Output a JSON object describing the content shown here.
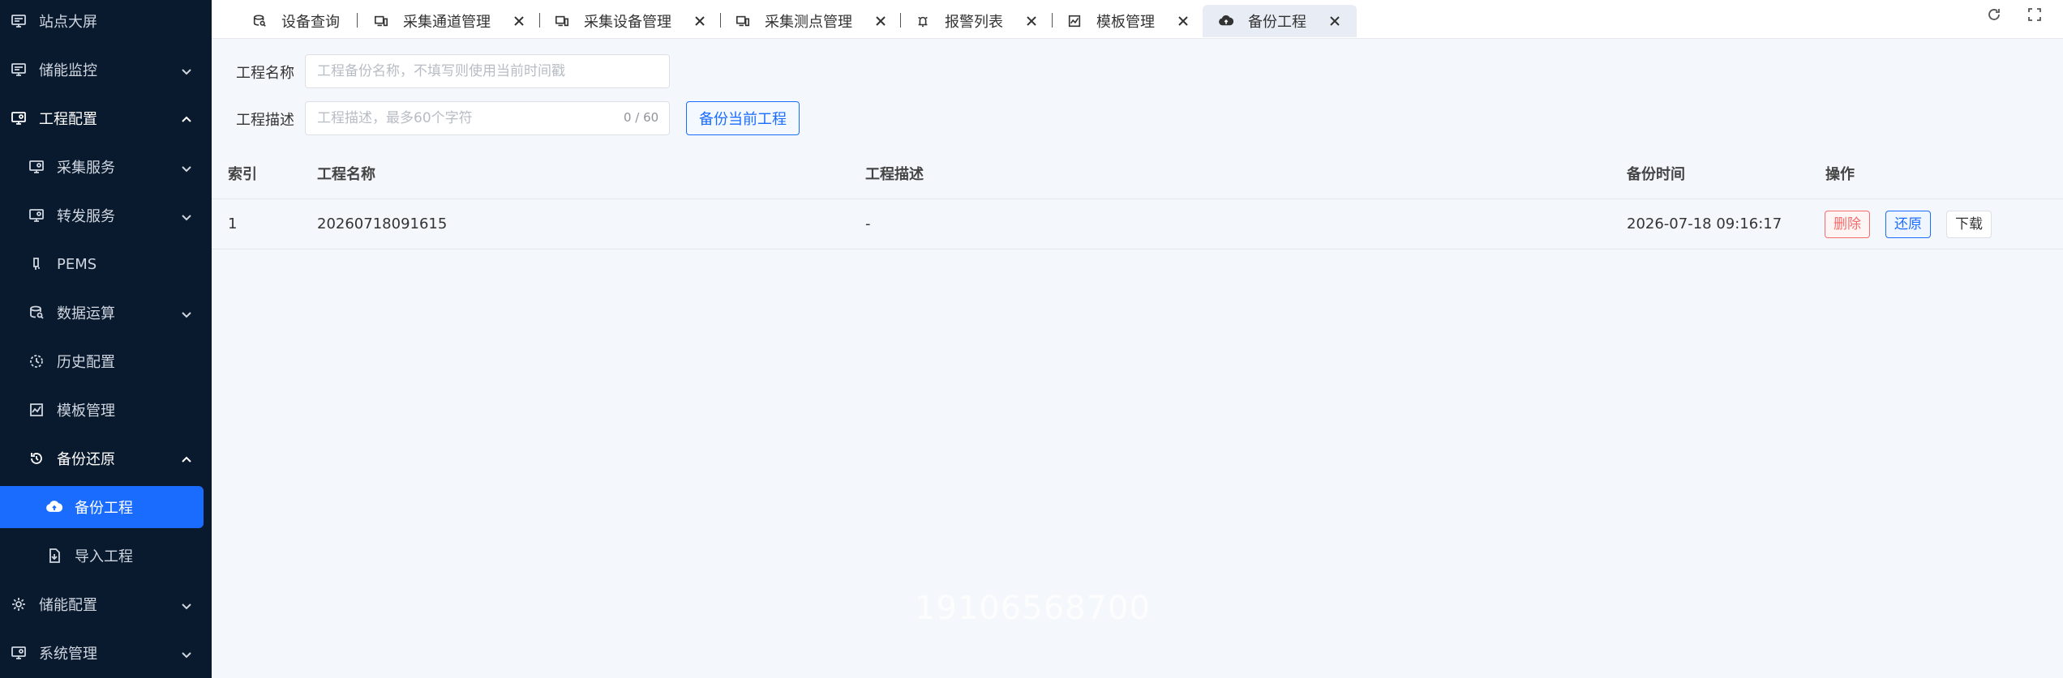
{
  "sidebar": {
    "items": [
      {
        "label": "站点大屏",
        "icon": "monitor-icon"
      },
      {
        "label": "储能监控",
        "icon": "monitor-icon"
      },
      {
        "label": "工程配置",
        "icon": "config-screen-icon"
      },
      {
        "label": "采集服务",
        "icon": "config-screen-icon"
      },
      {
        "label": "转发服务",
        "icon": "config-screen-icon"
      },
      {
        "label": "PEMS",
        "icon": "pems-icon"
      },
      {
        "label": "数据运算",
        "icon": "data-search-icon"
      },
      {
        "label": "历史配置",
        "icon": "history-icon"
      },
      {
        "label": "模板管理",
        "icon": "template-icon"
      },
      {
        "label": "备份还原",
        "icon": "restore-icon"
      },
      {
        "label": "备份工程",
        "icon": "cloud-upload-icon"
      },
      {
        "label": "导入工程",
        "icon": "file-import-icon"
      },
      {
        "label": "储能配置",
        "icon": "gear-icon"
      },
      {
        "label": "系统管理",
        "icon": "config-screen-icon"
      }
    ]
  },
  "tabs": [
    {
      "label": "设备查询",
      "icon": "data-search-icon"
    },
    {
      "label": "采集通道管理",
      "icon": "device-icon"
    },
    {
      "label": "采集设备管理",
      "icon": "device-icon"
    },
    {
      "label": "采集测点管理",
      "icon": "device-icon"
    },
    {
      "label": "报警列表",
      "icon": "alarm-icon"
    },
    {
      "label": "模板管理",
      "icon": "template-icon"
    },
    {
      "label": "备份工程",
      "icon": "cloud-upload-icon"
    }
  ],
  "form": {
    "name_label": "工程名称",
    "name_placeholder": "工程备份名称，不填写则使用当前时间戳",
    "desc_label": "工程描述",
    "desc_placeholder": "工程描述，最多60个字符",
    "desc_counter": "0 / 60",
    "backup_button": "备份当前工程"
  },
  "table": {
    "columns": [
      "索引",
      "工程名称",
      "工程描述",
      "备份时间",
      "操作"
    ],
    "rows": [
      {
        "index": "1",
        "name": "20260718091615",
        "desc": "-",
        "time": "2026-07-18 09:16:17"
      }
    ],
    "actions": {
      "delete": "删除",
      "restore": "还原",
      "download": "下载"
    }
  },
  "watermark": "19106568700",
  "colors": {
    "sidebar_bg": "#0a1a2e",
    "accent": "#1a6cff",
    "danger": "#f56c6c"
  }
}
